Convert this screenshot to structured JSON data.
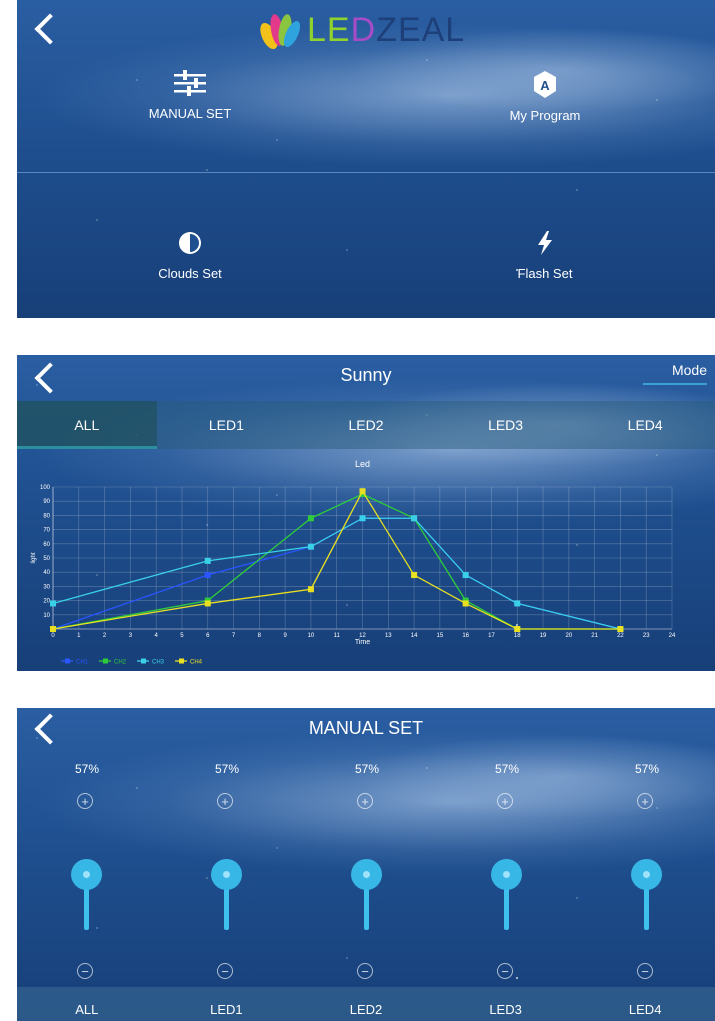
{
  "home": {
    "brand": {
      "part1": "L",
      "part2": "E",
      "part3": "D",
      "part4": "ZEAL"
    },
    "menu": [
      {
        "label": "MANUAL SET",
        "icon": "sliders-icon"
      },
      {
        "label": "My Program",
        "icon": "program-a-icon"
      },
      {
        "label": "Clouds Set",
        "icon": "half-sun-icon"
      },
      {
        "label": "Flash Set",
        "icon": "lightning-icon"
      }
    ]
  },
  "program": {
    "title": "Sunny",
    "mode_label": "Mode",
    "tabs": [
      "ALL",
      "LED1",
      "LED2",
      "LED3",
      "LED4"
    ],
    "active_tab": "ALL"
  },
  "chart_data": {
    "type": "line",
    "title": "Led",
    "xlabel": "Time",
    "ylabel": "light",
    "xlim": [
      0,
      24
    ],
    "ylim": [
      0,
      100
    ],
    "xticks": [
      0,
      1,
      2,
      3,
      4,
      5,
      6,
      7,
      8,
      9,
      10,
      11,
      12,
      13,
      14,
      15,
      16,
      17,
      18,
      19,
      20,
      21,
      22,
      23,
      24
    ],
    "yticks": [
      10,
      20,
      30,
      40,
      50,
      60,
      70,
      80,
      90,
      100
    ],
    "grid": true,
    "legend": "bottom-left",
    "series": [
      {
        "name": "CH1",
        "color": "#2a55ff",
        "points": [
          [
            0,
            0
          ],
          [
            6,
            38
          ],
          [
            10,
            58
          ],
          [
            12,
            78
          ],
          [
            14,
            78
          ],
          [
            16,
            38
          ],
          [
            18,
            18
          ],
          [
            22,
            0
          ]
        ]
      },
      {
        "name": "CH2",
        "color": "#2ecc3a",
        "points": [
          [
            0,
            0
          ],
          [
            6,
            20
          ],
          [
            10,
            78
          ],
          [
            12,
            95
          ],
          [
            14,
            78
          ],
          [
            16,
            20
          ],
          [
            18,
            0
          ],
          [
            22,
            0
          ]
        ]
      },
      {
        "name": "CH3",
        "color": "#3ad0e8",
        "points": [
          [
            0,
            18
          ],
          [
            6,
            48
          ],
          [
            10,
            58
          ],
          [
            12,
            78
          ],
          [
            14,
            78
          ],
          [
            16,
            38
          ],
          [
            18,
            18
          ],
          [
            22,
            0
          ]
        ]
      },
      {
        "name": "CH4",
        "color": "#e8e020",
        "points": [
          [
            0,
            0
          ],
          [
            6,
            18
          ],
          [
            10,
            28
          ],
          [
            12,
            97
          ],
          [
            14,
            38
          ],
          [
            16,
            18
          ],
          [
            18,
            0
          ],
          [
            22,
            0
          ]
        ]
      }
    ]
  },
  "manual": {
    "title": "MANUAL SET",
    "channels": [
      {
        "label": "ALL",
        "percent": "57%",
        "level": 0.57
      },
      {
        "label": "LED1",
        "percent": "57%",
        "level": 0.57
      },
      {
        "label": "LED2",
        "percent": "57%",
        "level": 0.57
      },
      {
        "label": "LED3",
        "percent": "57%",
        "level": 0.57
      },
      {
        "label": "LED4",
        "percent": "57%",
        "level": 0.57
      }
    ],
    "plus_symbol": "+",
    "minus_symbol": "−"
  }
}
